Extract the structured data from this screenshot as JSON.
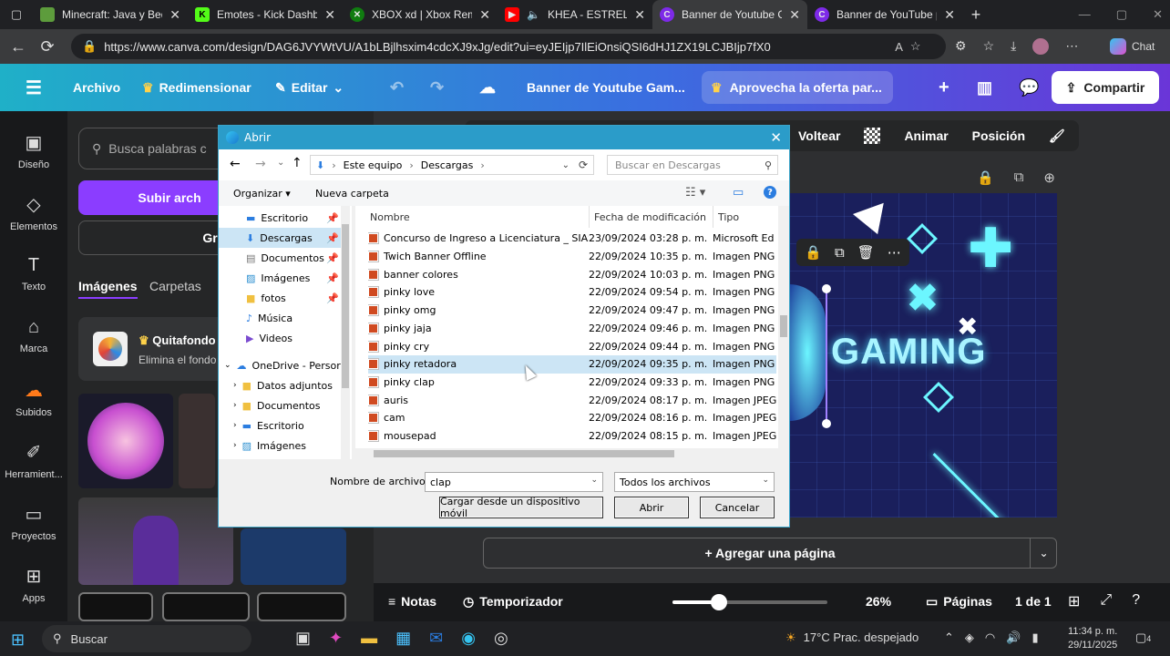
{
  "browser": {
    "tabs": [
      {
        "label": "Minecraft: Java y Bedro",
        "icon": "minecraft-icon"
      },
      {
        "label": "Emotes - Kick Dashboa",
        "icon": "kick-icon"
      },
      {
        "label": "XBOX xd | Xbox Remote",
        "icon": "xbox-icon"
      },
      {
        "label": "KHEA - ESTRELLAS",
        "icon": "youtube-icon"
      },
      {
        "label": "Banner de Youtube Gam",
        "icon": "canva-icon"
      },
      {
        "label": "Banner de YouTube par",
        "icon": "canva-icon"
      }
    ],
    "url": "https://www.canva.com/design/DAG6JVYWtVU/A1bLBjlhsxim4cdcXJ9xJg/edit?ui=eyJEIjp7IlEiOnsiQSI6dHJ1ZX19LCJBIjp7fX0",
    "chat_label": "Chat"
  },
  "canva": {
    "file_label": "Archivo",
    "resize_label": "Redimensionar",
    "edit_label": "Editar",
    "title": "Banner de Youtube Gam...",
    "promo_label": "Aprovecha la oferta par...",
    "share_label": "Compartir",
    "rail": [
      "Diseño",
      "Elementos",
      "Texto",
      "Marca",
      "Subidos",
      "Herramient...",
      "Proyectos",
      "Apps"
    ],
    "search_placeholder": "Busca palabras c",
    "upload_button": "Subir arch",
    "record_button": "Grab",
    "tab_images": "Imágenes",
    "tab_folders": "Carpetas",
    "promo_card_title": "Quitafondo",
    "promo_card_sub": "Elimina el fondo",
    "toolbar": [
      "Voltear",
      "Animar",
      "Posición"
    ],
    "design_text": "GAMING",
    "add_page": "+ Agregar una página",
    "notes": "Notas",
    "timer": "Temporizador",
    "zoom": "26%",
    "pages_label": "Páginas",
    "page_count": "1 de 1",
    "zoom_fraction": 0.3
  },
  "dialog": {
    "title": "Abrir",
    "breadcrumb": [
      "Este equipo",
      "Descargas"
    ],
    "search_placeholder": "Buscar en Descargas",
    "organize": "Organizar",
    "new_folder": "Nueva carpeta",
    "tree": [
      {
        "label": "Escritorio",
        "pinned": true
      },
      {
        "label": "Descargas",
        "pinned": true,
        "selected": true
      },
      {
        "label": "Documentos",
        "pinned": true
      },
      {
        "label": "Imágenes",
        "pinned": true
      },
      {
        "label": "fotos",
        "pinned": true
      },
      {
        "label": "Música",
        "pinned": false
      },
      {
        "label": "Videos",
        "pinned": false
      },
      {
        "label": "OneDrive - Persor",
        "pinned": false
      },
      {
        "label": "Datos adjuntos",
        "pinned": false
      },
      {
        "label": "Documentos",
        "pinned": false
      },
      {
        "label": "Escritorio",
        "pinned": false
      },
      {
        "label": "Imágenes",
        "pinned": false
      }
    ],
    "columns": {
      "name": "Nombre",
      "date": "Fecha de modificación",
      "type": "Tipo"
    },
    "files": [
      {
        "name": "Concurso de Ingreso a Licenciatura _ SIASE",
        "date": "23/09/2024 03:28 p. m.",
        "type": "Microsoft Ed"
      },
      {
        "name": "Twich Banner Offline",
        "date": "22/09/2024 10:35 p. m.",
        "type": "Imagen PNG"
      },
      {
        "name": "banner colores",
        "date": "22/09/2024 10:03 p. m.",
        "type": "Imagen PNG"
      },
      {
        "name": "pinky love",
        "date": "22/09/2024 09:54 p. m.",
        "type": "Imagen PNG"
      },
      {
        "name": "pinky omg",
        "date": "22/09/2024 09:47 p. m.",
        "type": "Imagen PNG"
      },
      {
        "name": "pinky jaja",
        "date": "22/09/2024 09:46 p. m.",
        "type": "Imagen PNG"
      },
      {
        "name": "pinky cry",
        "date": "22/09/2024 09:44 p. m.",
        "type": "Imagen PNG"
      },
      {
        "name": "pinky retadora",
        "date": "22/09/2024 09:35 p. m.",
        "type": "Imagen PNG"
      },
      {
        "name": "pinky clap",
        "date": "22/09/2024 09:33 p. m.",
        "type": "Imagen PNG"
      },
      {
        "name": "auris",
        "date": "22/09/2024 08:17 p. m.",
        "type": "Imagen JPEG"
      },
      {
        "name": "cam",
        "date": "22/09/2024 08:16 p. m.",
        "type": "Imagen JPEG"
      },
      {
        "name": "mousepad",
        "date": "22/09/2024 08:15 p. m.",
        "type": "Imagen JPEG"
      }
    ],
    "filename_label": "Nombre de archivo:",
    "filename_value": "clap",
    "filter_value": "Todos los archivos",
    "mobile_button": "Cargar desde un dispositivo móvil",
    "open_button": "Abrir",
    "cancel_button": "Cancelar"
  },
  "taskbar": {
    "search": "Buscar",
    "weather": "17°C  Prac. despejado",
    "time": "11:34 p. m.",
    "date": "29/11/2025",
    "notif_count": "4"
  }
}
